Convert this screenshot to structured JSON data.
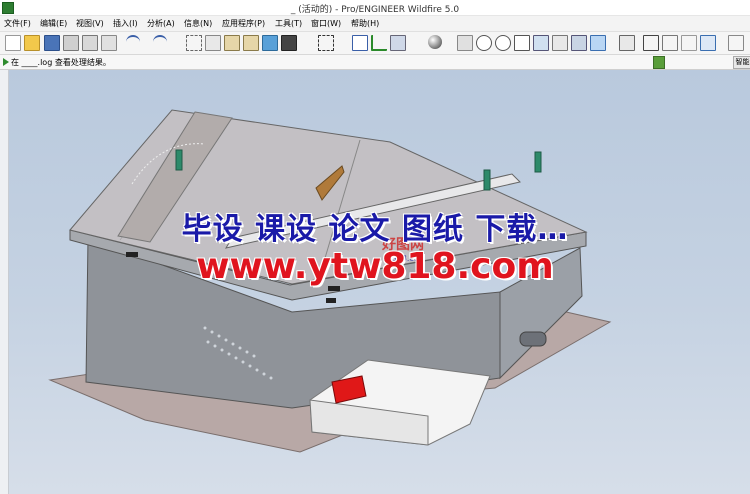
{
  "window": {
    "title": "_ (活动的) - Pro/ENGINEER Wildfire 5.0"
  },
  "menu": {
    "items": [
      {
        "label": "文件(F)"
      },
      {
        "label": "编辑(E)"
      },
      {
        "label": "视图(V)"
      },
      {
        "label": "插入(I)"
      },
      {
        "label": "分析(A)"
      },
      {
        "label": "信息(N)"
      },
      {
        "label": "应用程序(P)"
      },
      {
        "label": "工具(T)"
      },
      {
        "label": "窗口(W)"
      },
      {
        "label": "帮助(H)"
      }
    ]
  },
  "toolbar": {
    "buttons": [
      {
        "name": "new-icon"
      },
      {
        "name": "open-icon"
      },
      {
        "name": "save-icon"
      },
      {
        "name": "print-icon"
      },
      {
        "name": "send-icon"
      },
      {
        "name": "print-preview-icon"
      },
      {
        "name": "undo-icon"
      },
      {
        "name": "redo-icon"
      },
      {
        "name": "cut-icon"
      },
      {
        "name": "copy-icon"
      },
      {
        "name": "paste-icon"
      },
      {
        "name": "paste-special-icon"
      },
      {
        "name": "regenerate-icon"
      },
      {
        "name": "find-icon"
      },
      {
        "name": "select-box-icon"
      },
      {
        "name": "sketch-icon"
      },
      {
        "name": "datum-icon"
      },
      {
        "name": "appearance-icon"
      },
      {
        "name": "sphere-icon"
      },
      {
        "name": "refit-icon"
      },
      {
        "name": "zoom-in-icon"
      },
      {
        "name": "zoom-out-icon"
      },
      {
        "name": "zoom-fit-icon"
      },
      {
        "name": "reorient-icon"
      },
      {
        "name": "saved-views-icon"
      },
      {
        "name": "layers-icon"
      },
      {
        "name": "display-style-icon"
      },
      {
        "name": "model-tree-icon"
      },
      {
        "name": "wireframe-icon"
      },
      {
        "name": "hidden-line-icon"
      },
      {
        "name": "no-hidden-icon"
      },
      {
        "name": "shading-icon"
      },
      {
        "name": "close-window-icon"
      }
    ]
  },
  "status": {
    "message": "在 ____.log 查看处理结果。",
    "button_label": "智能"
  },
  "watermark": {
    "line1": "毕设 课设 论文 图纸 下载…",
    "line2": "www.ytw818.com",
    "logo_text": "好图网",
    "logo_sub": "w818.co"
  },
  "colors": {
    "watermark_blue": "#1a1aa8",
    "watermark_red": "#e0141e",
    "viewport_bg": "#c5d2e2",
    "model_gray": "#9a9ea8",
    "red_button": "#e01818"
  }
}
